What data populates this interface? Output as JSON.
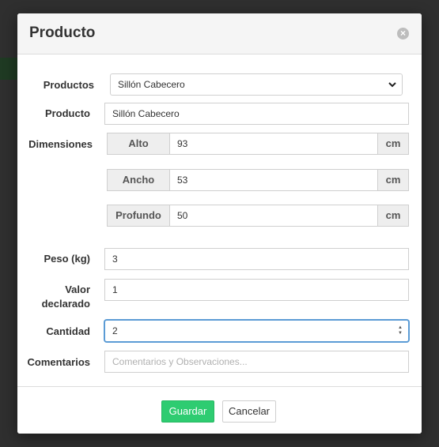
{
  "modal": {
    "title": "Producto",
    "close_symbol": "×"
  },
  "form": {
    "productos": {
      "label": "Productos",
      "selected": "Sillón Cabecero"
    },
    "producto": {
      "label": "Producto",
      "value": "Sillón Cabecero"
    },
    "dimensiones": {
      "label": "Dimensiones",
      "alto": {
        "label": "Alto",
        "value": "93",
        "unit": "cm"
      },
      "ancho": {
        "label": "Ancho",
        "value": "53",
        "unit": "cm"
      },
      "profundo": {
        "label": "Profundo",
        "value": "50",
        "unit": "cm"
      }
    },
    "peso": {
      "label": "Peso (kg)",
      "value": "3"
    },
    "valor_declarado": {
      "label_line1": "Valor",
      "label_line2": "declarado",
      "value": "1"
    },
    "cantidad": {
      "label": "Cantidad",
      "value": "2"
    },
    "comentarios": {
      "label": "Comentarios",
      "placeholder": "Comentarios y Observaciones..."
    }
  },
  "footer": {
    "save_label": "Guardar",
    "cancel_label": "Cancelar"
  },
  "colors": {
    "save_button": "#2ecc71",
    "focus_border": "#5b9bd5",
    "addon_bg": "#eeeeee"
  },
  "icons": {
    "close": "close-icon",
    "select_chevron": "chevron-down-icon",
    "spinner": "spinner-arrows-icon"
  }
}
